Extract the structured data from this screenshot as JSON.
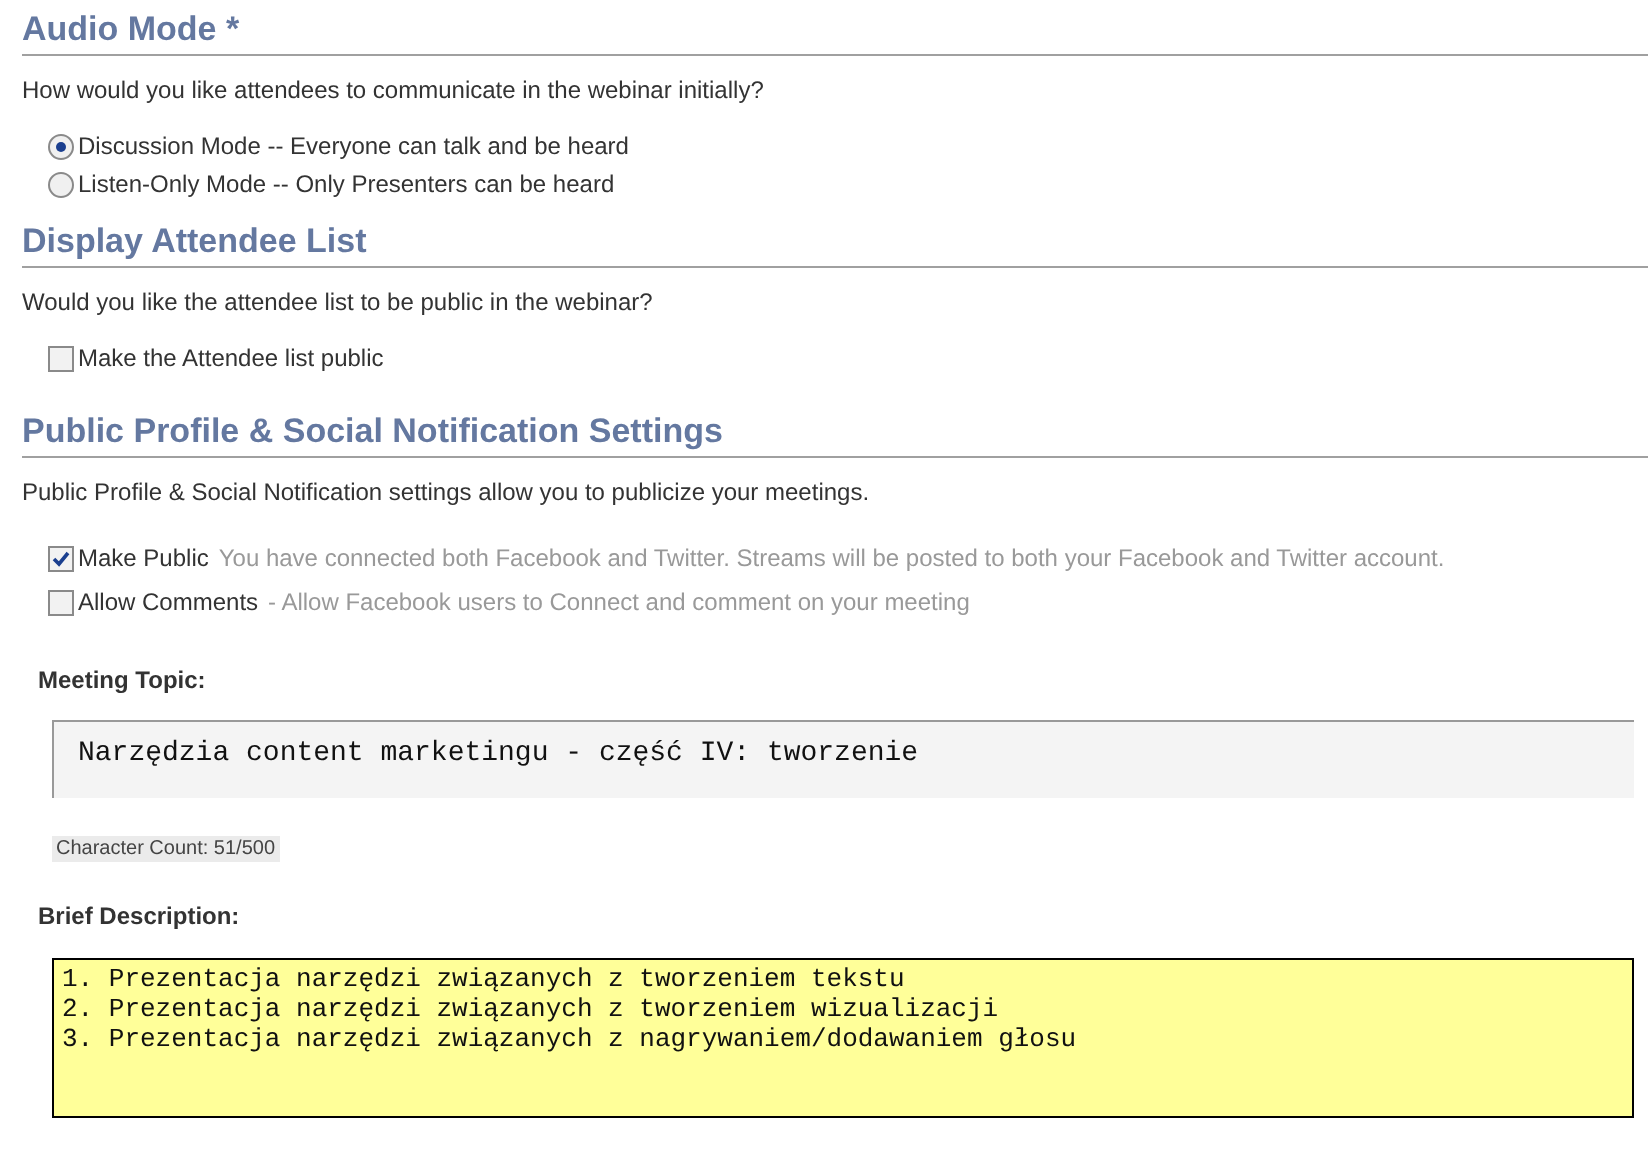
{
  "sections": [
    {
      "heading": "Audio Mode *",
      "prompt": "How would you like attendees to communicate in the webinar initially?",
      "options": [
        {
          "kind": "radio",
          "label": "Discussion Mode -- Everyone can talk and be heard",
          "selected": true
        },
        {
          "kind": "radio",
          "label": "Listen-Only Mode -- Only Presenters can be heard",
          "selected": false
        }
      ]
    },
    {
      "heading": "Display Attendee List",
      "prompt": "Would you like the attendee list to be public in the webinar?",
      "options": [
        {
          "kind": "checkbox",
          "label": "Make the Attendee list public",
          "checked": false
        }
      ]
    },
    {
      "heading": "Public Profile & Social Notification Settings",
      "prompt": "Public Profile & Social Notification settings allow you to publicize your meetings.",
      "options": [
        {
          "kind": "checkbox",
          "label": "Make Public",
          "note": "You have connected both Facebook and Twitter. Streams will be posted to both your Facebook and Twitter account.",
          "checked": true
        },
        {
          "kind": "checkbox",
          "label": "Allow Comments",
          "note": "- Allow Facebook users to Connect and comment on your meeting",
          "checked": false
        }
      ]
    }
  ],
  "meeting_topic": {
    "label": "Meeting Topic:",
    "value": "Narzędzia content marketingu - część IV: tworzenie",
    "character_count": "Character Count: 51/500"
  },
  "brief_description": {
    "label": "Brief Description:",
    "value": "1. Prezentacja narzędzi związanych z tworzeniem tekstu\n2. Prezentacja narzędzi związanych z tworzeniem wizualizacji\n3. Prezentacja narzędzi związanych z nagrywaniem/dodawaniem głosu"
  }
}
